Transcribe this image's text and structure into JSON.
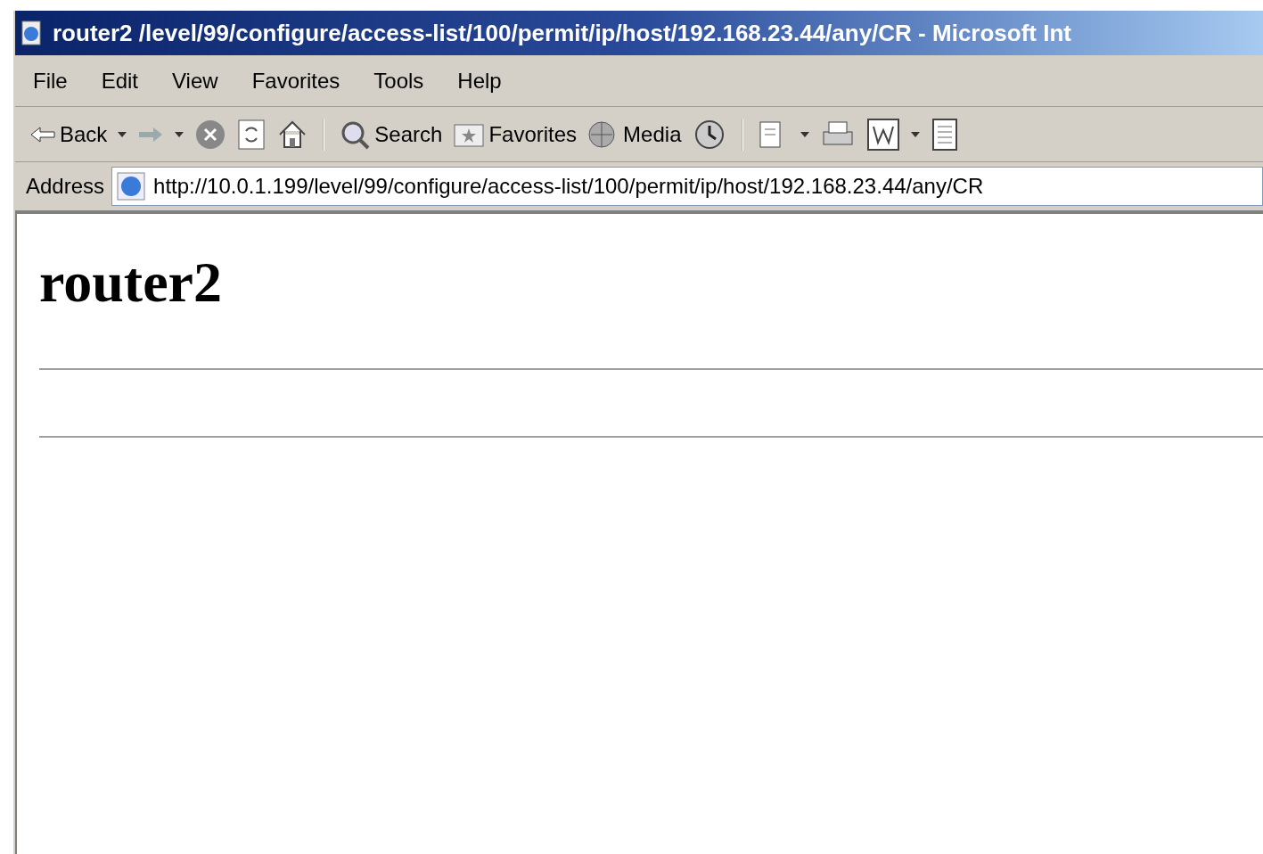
{
  "window": {
    "title": "router2 /level/99/configure/access-list/100/permit/ip/host/192.168.23.44/any/CR - Microsoft Int"
  },
  "menu": [
    "File",
    "Edit",
    "View",
    "Favorites",
    "Tools",
    "Help"
  ],
  "toolbar": {
    "back": "Back",
    "search": "Search",
    "favorites": "Favorites",
    "media": "Media"
  },
  "address": {
    "label": "Address",
    "value": "http://10.0.1.199/level/99/configure/access-list/100/permit/ip/host/192.168.23.44/any/CR"
  },
  "page": {
    "heading": "router2"
  }
}
